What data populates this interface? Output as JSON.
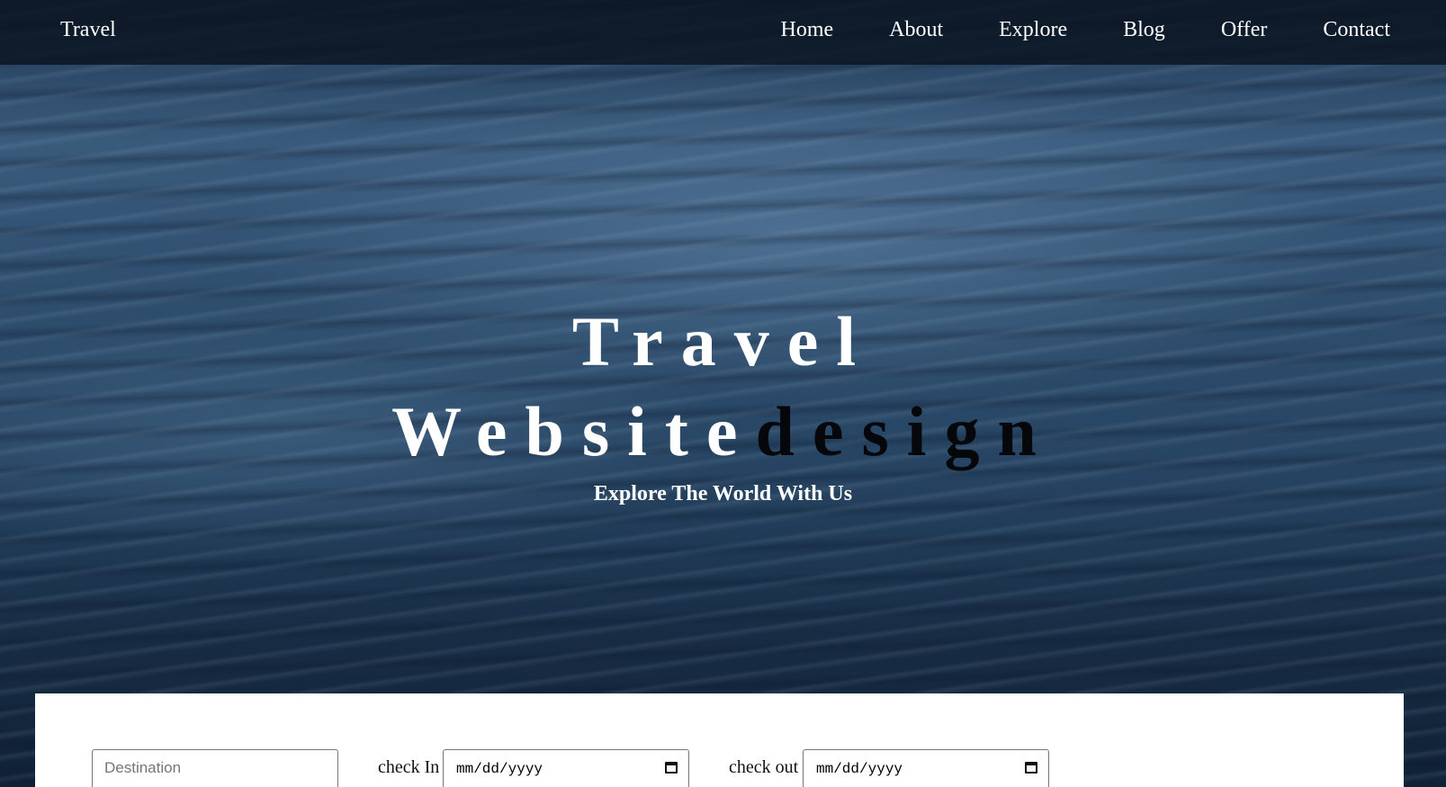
{
  "nav": {
    "brand": "Travel",
    "links": [
      "Home",
      "About",
      "Explore",
      "Blog",
      "Offer",
      "Contact"
    ]
  },
  "hero": {
    "headline_line1": "Travel",
    "headline_line2_light": "Website",
    "headline_line2_dark": "design",
    "tagline": "Explore The World With Us"
  },
  "booking": {
    "destination_placeholder": "Destination",
    "checkin_label": "check In",
    "checkin_value": "mm/dd/yyyy",
    "checkout_label": "check out",
    "checkout_value": "mm/dd/yyyy"
  },
  "icons": {
    "checkin_icon": "calendar-icon",
    "checkout_icon": "calendar-icon"
  }
}
